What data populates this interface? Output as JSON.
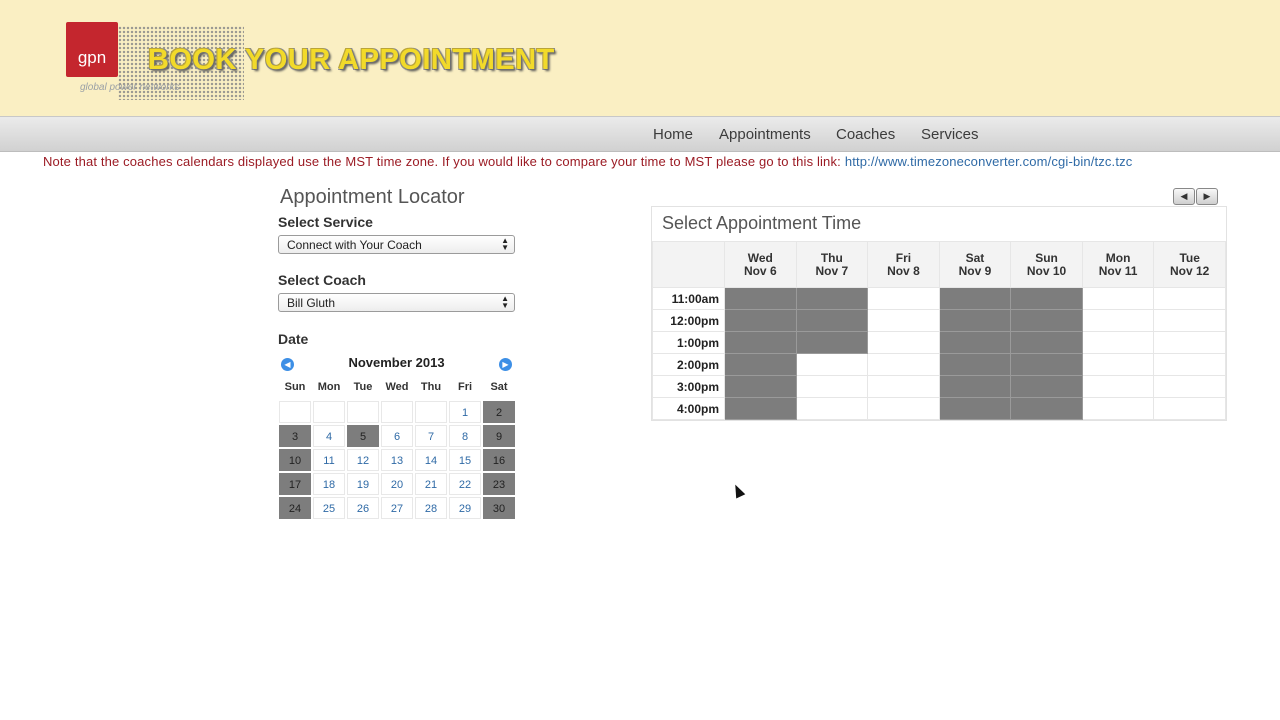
{
  "header": {
    "logo_text": "gpn",
    "tagline": "global power networks",
    "banner_title": "BOOK YOUR APPOINTMENT"
  },
  "nav": {
    "items": [
      "Home",
      "Appointments",
      "Coaches",
      "Services"
    ]
  },
  "note": {
    "text": "Note that the coaches calendars displayed use the MST time zone. If you would like to compare your time to MST please go to this link:",
    "link": "http://www.timezoneconverter.com/cgi-bin/tzc.tzc"
  },
  "locator": {
    "title": "Appointment Locator",
    "service_label": "Select Service",
    "service_value": "Connect with Your Coach",
    "coach_label": "Select Coach",
    "coach_value": "Bill Gluth",
    "date_label": "Date"
  },
  "mini_calendar": {
    "title": "November 2013",
    "weekdays": [
      "Sun",
      "Mon",
      "Tue",
      "Wed",
      "Thu",
      "Fri",
      "Sat"
    ],
    "leading_blanks": 5,
    "days": [
      1,
      2,
      3,
      4,
      5,
      6,
      7,
      8,
      9,
      10,
      11,
      12,
      13,
      14,
      15,
      16,
      17,
      18,
      19,
      20,
      21,
      22,
      23,
      24,
      25,
      26,
      27,
      28,
      29,
      30
    ],
    "unavailable": [
      2,
      3,
      5,
      9,
      10,
      16,
      17,
      23,
      24,
      30
    ],
    "colors": {
      "unavailable": "#7d7d7d",
      "link": "#2f6aa6"
    }
  },
  "week_view": {
    "title": "Select Appointment Time",
    "days": [
      {
        "dow": "Wed",
        "date": "Nov 6"
      },
      {
        "dow": "Thu",
        "date": "Nov 7"
      },
      {
        "dow": "Fri",
        "date": "Nov 8"
      },
      {
        "dow": "Sat",
        "date": "Nov 9"
      },
      {
        "dow": "Sun",
        "date": "Nov 10"
      },
      {
        "dow": "Mon",
        "date": "Nov 11"
      },
      {
        "dow": "Tue",
        "date": "Nov 12"
      }
    ],
    "times": [
      "11:00am",
      "12:00pm",
      "1:00pm",
      "2:00pm",
      "3:00pm",
      "4:00pm"
    ],
    "busy": [
      [
        1,
        1,
        0,
        1,
        1,
        0,
        0
      ],
      [
        1,
        1,
        0,
        1,
        1,
        0,
        0
      ],
      [
        1,
        1,
        0,
        1,
        1,
        0,
        0
      ],
      [
        1,
        0,
        0,
        1,
        1,
        0,
        0
      ],
      [
        1,
        0,
        0,
        1,
        1,
        0,
        0
      ],
      [
        1,
        0,
        0,
        1,
        1,
        0,
        0
      ]
    ],
    "prev_icon": "triangle-left-icon",
    "next_icon": "triangle-right-icon"
  }
}
